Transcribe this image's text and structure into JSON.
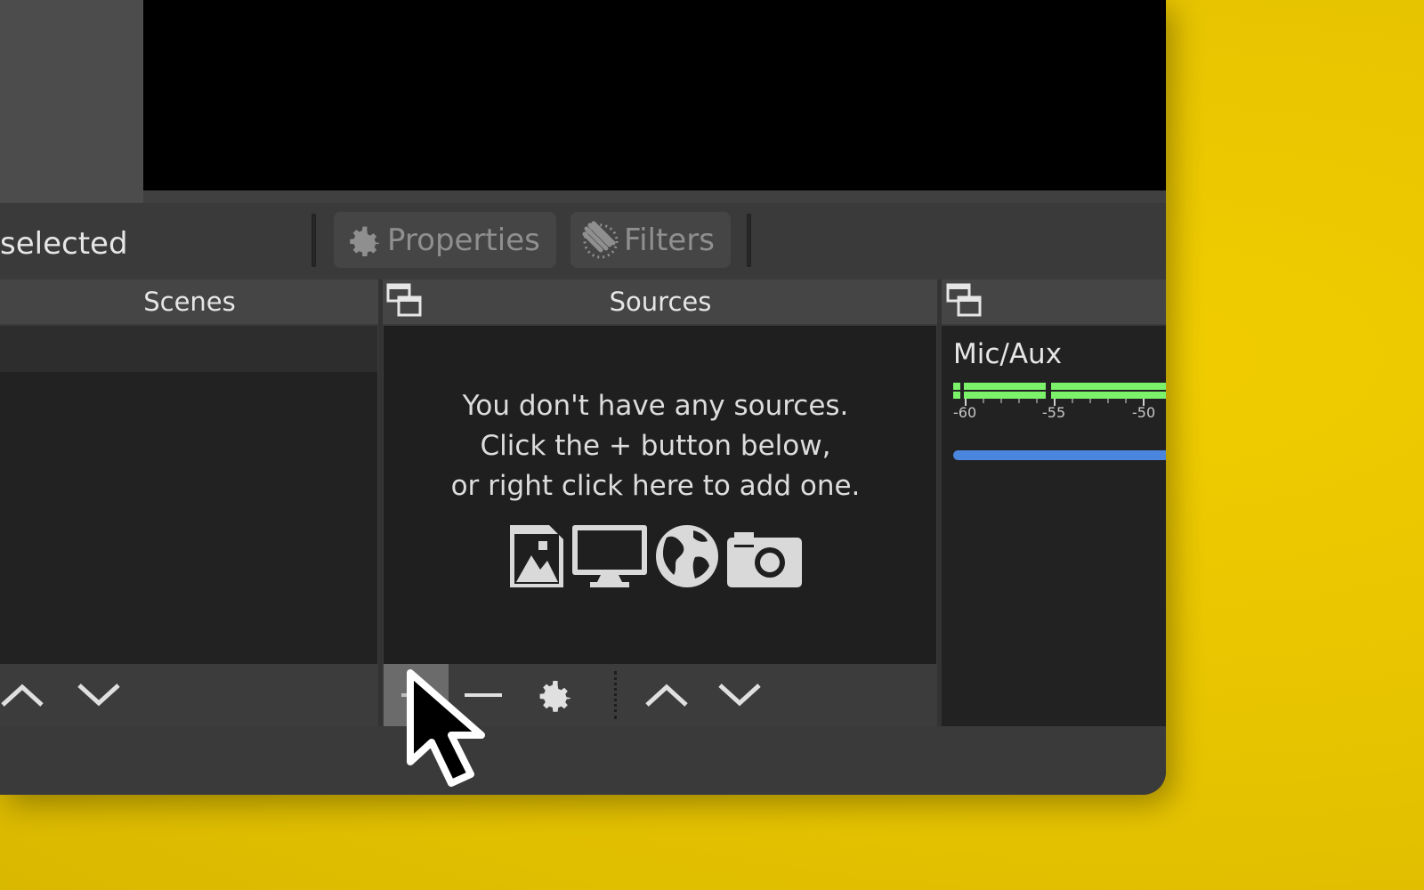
{
  "window": {
    "context_bar": {
      "no_source_label": "selected",
      "properties_label": "Properties",
      "filters_label": "Filters"
    },
    "docks": {
      "scenes": {
        "title": "Scenes"
      },
      "sources": {
        "title": "Sources",
        "empty_message": [
          "You don't have any sources.",
          "Click the + button below,",
          "or right click here to add one."
        ],
        "source_type_icons": [
          "image-icon",
          "monitor-icon",
          "globe-icon",
          "camera-icon"
        ]
      },
      "audio_mixer": {
        "channel_name": "Mic/Aux",
        "meter_ticks": [
          "-60",
          "-55",
          "-50"
        ]
      }
    }
  },
  "colors": {
    "background": "#e8c400",
    "meter_green": "#7cf26a",
    "volume_blue": "#4a86de",
    "add_button_highlight": "#6b6b6b"
  }
}
